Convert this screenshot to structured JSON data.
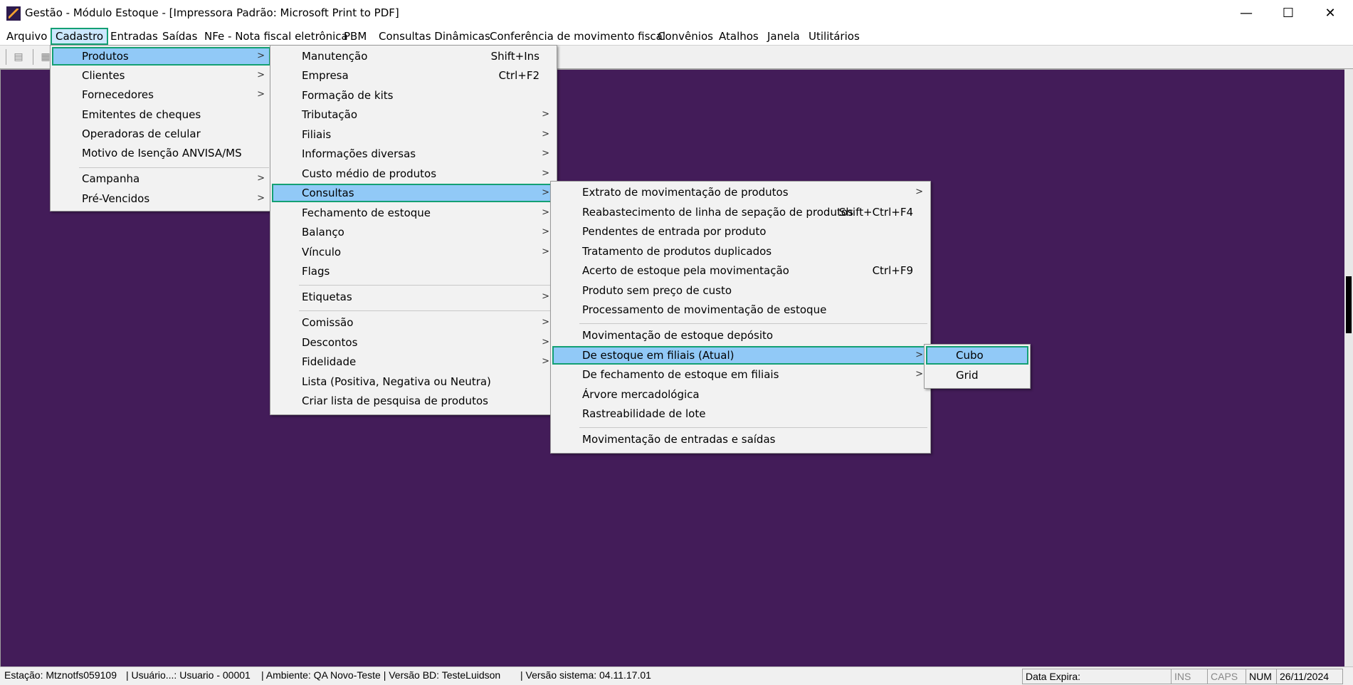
{
  "window": {
    "title": "Gestão  - Módulo Estoque - [Impressora Padrão: Microsoft Print to PDF]",
    "controls": {
      "minimize": "—",
      "maximize": "☐",
      "close": "✕"
    }
  },
  "menubar": [
    {
      "label": "Arquivo"
    },
    {
      "label": "Cadastro"
    },
    {
      "label": "Entradas"
    },
    {
      "label": "Saídas"
    },
    {
      "label": "NFe - Nota fiscal eletrônica"
    },
    {
      "label": "PBM"
    },
    {
      "label": "Consultas Dinâmicas"
    },
    {
      "label": "Conferência de movimento fiscal"
    },
    {
      "label": "Convênios"
    },
    {
      "label": "Atalhos"
    },
    {
      "label": "Janela"
    },
    {
      "label": "Utilitários"
    }
  ],
  "menu_cadastro": [
    {
      "label": "Produtos",
      "arrow": ">"
    },
    {
      "label": "Clientes",
      "arrow": ">"
    },
    {
      "label": "Fornecedores",
      "arrow": ">"
    },
    {
      "label": "Emitentes de cheques"
    },
    {
      "label": "Operadoras de celular"
    },
    {
      "label": "Motivo de Isenção ANVISA/MS"
    },
    {
      "label": "Campanha",
      "arrow": ">"
    },
    {
      "label": "Pré-Vencidos",
      "arrow": ">"
    }
  ],
  "menu_produtos": [
    {
      "label": "Manutenção",
      "shortcut": "Shift+Ins"
    },
    {
      "label": "Empresa",
      "shortcut": "Ctrl+F2"
    },
    {
      "label": "Formação de kits"
    },
    {
      "label": "Tributação",
      "arrow": ">"
    },
    {
      "label": "Filiais",
      "arrow": ">"
    },
    {
      "label": "Informações diversas",
      "arrow": ">"
    },
    {
      "label": "Custo médio de produtos",
      "arrow": ">"
    },
    {
      "label": "Consultas",
      "arrow": ">"
    },
    {
      "label": "Fechamento de estoque",
      "arrow": ">"
    },
    {
      "label": "Balanço",
      "arrow": ">"
    },
    {
      "label": "Vínculo",
      "arrow": ">"
    },
    {
      "label": "Flags"
    },
    {
      "label": "Etiquetas",
      "arrow": ">"
    },
    {
      "label": "Comissão",
      "arrow": ">"
    },
    {
      "label": "Descontos",
      "arrow": ">"
    },
    {
      "label": "Fidelidade",
      "arrow": ">"
    },
    {
      "label": "Lista (Positiva, Negativa ou Neutra)"
    },
    {
      "label": "Criar lista de pesquisa de produtos"
    }
  ],
  "menu_consultas": [
    {
      "label": "Extrato de movimentação de produtos",
      "arrow": ">"
    },
    {
      "label": "Reabastecimento de linha de sepação de produtos",
      "shortcut": "Shift+Ctrl+F4"
    },
    {
      "label": "Pendentes de entrada por produto"
    },
    {
      "label": "Tratamento de produtos duplicados"
    },
    {
      "label": "Acerto de estoque pela movimentação",
      "shortcut": "Ctrl+F9"
    },
    {
      "label": "Produto sem preço de custo"
    },
    {
      "label": "Processamento de movimentação de estoque"
    },
    {
      "label": "Movimentação de estoque depósito"
    },
    {
      "label": "De estoque em filiais (Atual)",
      "arrow": ">"
    },
    {
      "label": "De fechamento de estoque em filiais",
      "arrow": ">"
    },
    {
      "label": "Árvore mercadológica"
    },
    {
      "label": "Rastreabilidade de lote"
    },
    {
      "label": "Movimentação de entradas e saídas"
    }
  ],
  "menu_filiais": [
    {
      "label": "Cubo"
    },
    {
      "label": "Grid"
    }
  ],
  "statusbar": {
    "estacao": "Estação: Mtznotfs059109",
    "usuario": "| Usuário...: Usuario - 00001",
    "ambiente": "| Ambiente: QA Novo-Teste | Versão BD: TesteLuidson",
    "versao": "| Versão sistema: 04.11.17.01",
    "data_expira": "Data Expira:",
    "ins": "INS",
    "caps": "CAPS",
    "num": "NUM",
    "date": "26/11/2024"
  },
  "colors": {
    "workspace": "#431c59",
    "highlight": "#91c9f7",
    "highlight_border": "#14a074"
  }
}
